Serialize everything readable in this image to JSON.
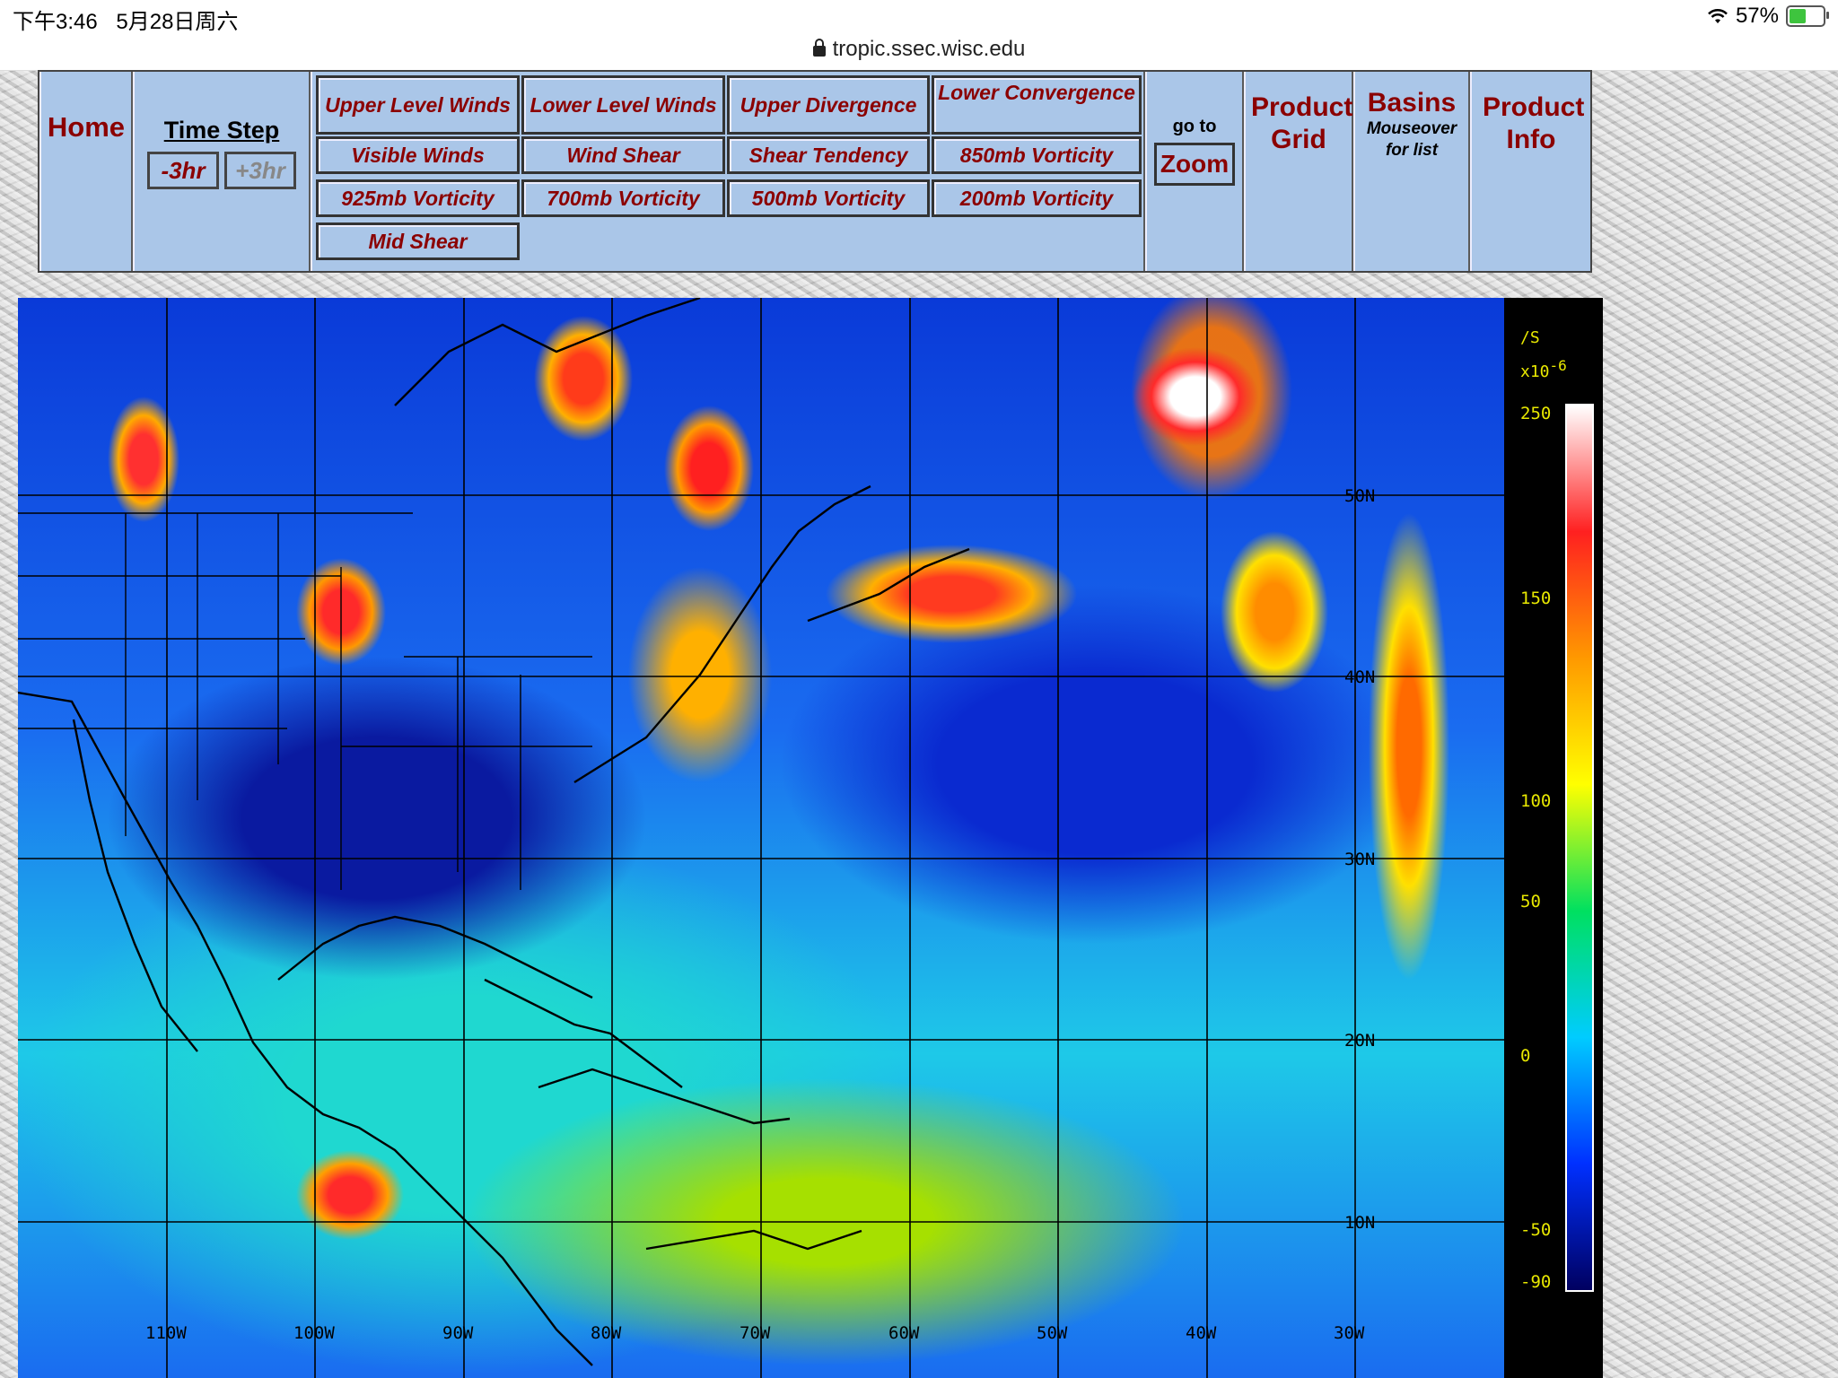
{
  "status_bar": {
    "time": "下午3:46",
    "date": "5月28日周六",
    "battery": "57%",
    "battery_level": 0.57
  },
  "browser": {
    "url": "tropic.ssec.wisc.edu"
  },
  "nav": {
    "home": "Home",
    "time_step": {
      "title": "Time Step",
      "back": "-3hr",
      "forward": "+3hr"
    },
    "products": [
      "Upper Level Winds",
      "Lower Level Winds",
      "Upper Divergence",
      "Lower Convergence",
      "Visible Winds",
      "Wind Shear",
      "Shear Tendency",
      "850mb Vorticity",
      "925mb Vorticity",
      "700mb Vorticity",
      "500mb Vorticity",
      "200mb Vorticity",
      "Mid Shear"
    ],
    "goto": "go to",
    "zoom": "Zoom",
    "product_grid": "Product Grid",
    "basins": {
      "title": "Basins",
      "subtitle": "Mouseover for list"
    },
    "product_info": "Product Info"
  },
  "map": {
    "lat_labels": [
      "50N",
      "40N",
      "30N",
      "20N",
      "10N"
    ],
    "lon_labels": [
      "110W",
      "100W",
      "90W",
      "80W",
      "70W",
      "60W",
      "50W",
      "40W",
      "30W"
    ]
  },
  "colorbar": {
    "units_line1": "/S",
    "units_line2": "x10",
    "exponent": "-6",
    "ticks": [
      "250",
      "150",
      "100",
      "50",
      "0",
      "-50",
      "-90"
    ],
    "colors": [
      "#ffffff",
      "#ff2020",
      "#ff9900",
      "#ffff00",
      "#00e060",
      "#00ccff",
      "#0030ff",
      "#000060"
    ]
  }
}
